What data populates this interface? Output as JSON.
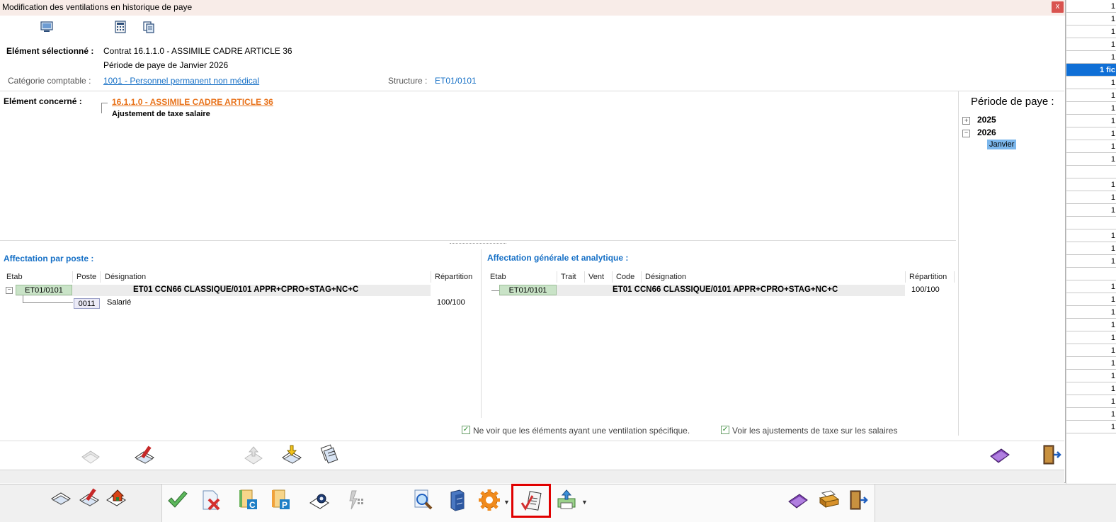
{
  "window": {
    "title": "Modification des ventilations en historique de paye",
    "close_label": "x"
  },
  "selection": {
    "label": "Elément sélectionné :",
    "line1": "Contrat 16.1.1.0 - ASSIMILE CADRE ARTICLE 36",
    "line2": "Période de paye de Janvier 2026",
    "category_label": "Catégorie comptable :",
    "category_value": "1001 - Personnel permanent non médical",
    "structure_label": "Structure :",
    "structure_value": "ET01/0101"
  },
  "concerned": {
    "label": "Elément concerné :",
    "parent": "16.1.1.0 - ASSIMILE CADRE ARTICLE 36",
    "child": "Ajustement de taxe salaire"
  },
  "period": {
    "title": "Période de paye :",
    "years": [
      {
        "year": "2025",
        "expanded": false
      },
      {
        "year": "2026",
        "expanded": true
      }
    ],
    "selected_month": "Janvier"
  },
  "affectation_poste": {
    "title": "Affectation par poste :",
    "columns": [
      "Etab",
      "Poste",
      "Désignation",
      "Répartition"
    ],
    "row1": {
      "etab": "ET01/0101",
      "designation": "ET01 CCN66 CLASSIQUE/0101 APPR+CPRO+STAG+NC+C"
    },
    "row2": {
      "poste": "0011",
      "designation": "Salarié",
      "repartition": "100/100"
    }
  },
  "affectation_generale": {
    "title": "Affectation générale et analytique :",
    "columns": [
      "Etab",
      "Trait",
      "Vent",
      "Code",
      "Désignation",
      "Répartition"
    ],
    "row1": {
      "etab": "ET01/0101",
      "designation": "ET01 CCN66 CLASSIQUE/0101 APPR+CPRO+STAG+NC+C",
      "repartition": "100/100"
    }
  },
  "options": {
    "specific_label": "Ne voir que les éléments ayant une ventilation spécifique.",
    "specific_checked": true,
    "tax_label": "Voir les ajustements de taxe sur les salaires",
    "tax_checked": true
  },
  "background_list": {
    "values": [
      "1",
      "1",
      "1",
      "1",
      "1",
      "1 fic",
      "1",
      "1",
      "1",
      "1",
      "1",
      "1",
      "1",
      "",
      "1",
      "1",
      "1",
      "",
      "1",
      "1",
      "1",
      "",
      "1",
      "1",
      "1",
      "1",
      "1",
      "1",
      "1",
      "1",
      "1",
      "1",
      "1",
      "1"
    ]
  },
  "colors": {
    "accent_blue": "#1670c6",
    "link_orange": "#e8731c",
    "highlight_red": "#e00000",
    "selection_blue": "#0f6fd6"
  }
}
